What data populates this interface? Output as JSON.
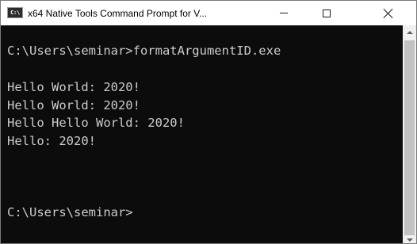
{
  "window": {
    "title": "x64 Native Tools Command Prompt for V...",
    "app_icon_text": "C:\\",
    "minimize_glyph": "minimize-icon",
    "maximize_glyph": "maximize-icon",
    "close_glyph": "close-icon"
  },
  "console": {
    "lines": [
      "C:\\Users\\seminar>formatArgumentID.exe",
      "Hello World: 2020!",
      "Hello World: 2020!",
      "Hello Hello World: 2020!",
      "Hello: 2020!",
      "C:\\Users\\seminar>"
    ],
    "text_color": "#cccccc",
    "background_color": "#0c0c0c"
  },
  "scrollbar": {
    "up_icon": "scroll-up-arrow-icon",
    "down_icon": "scroll-down-arrow-icon"
  }
}
